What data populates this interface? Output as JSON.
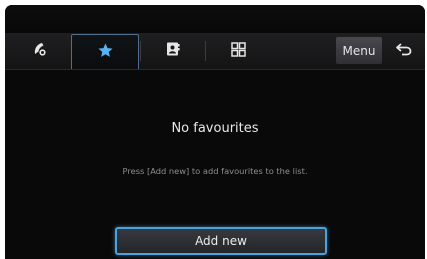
{
  "colors": {
    "screen_background": "#090909",
    "tab_bar_background": "#1f1f21",
    "active_tab_icon": "#58b3f5",
    "inactive_tab_icon": "#e6e6e6",
    "button_highlight": "#4aa3e0",
    "hint_text": "#8e8e8e"
  },
  "tabs": [
    {
      "icon": "phone-handset-icon",
      "active": false
    },
    {
      "icon": "star-icon",
      "active": true
    },
    {
      "icon": "contact-book-icon",
      "active": false
    },
    {
      "icon": "keypad-grid-icon",
      "active": false
    }
  ],
  "header": {
    "menu_label": "Menu",
    "back_icon": "back-arrow-icon"
  },
  "main": {
    "empty_title": "No favourites",
    "empty_hint": "Press [Add new] to add favourites to the list.",
    "add_button_label": "Add new"
  }
}
